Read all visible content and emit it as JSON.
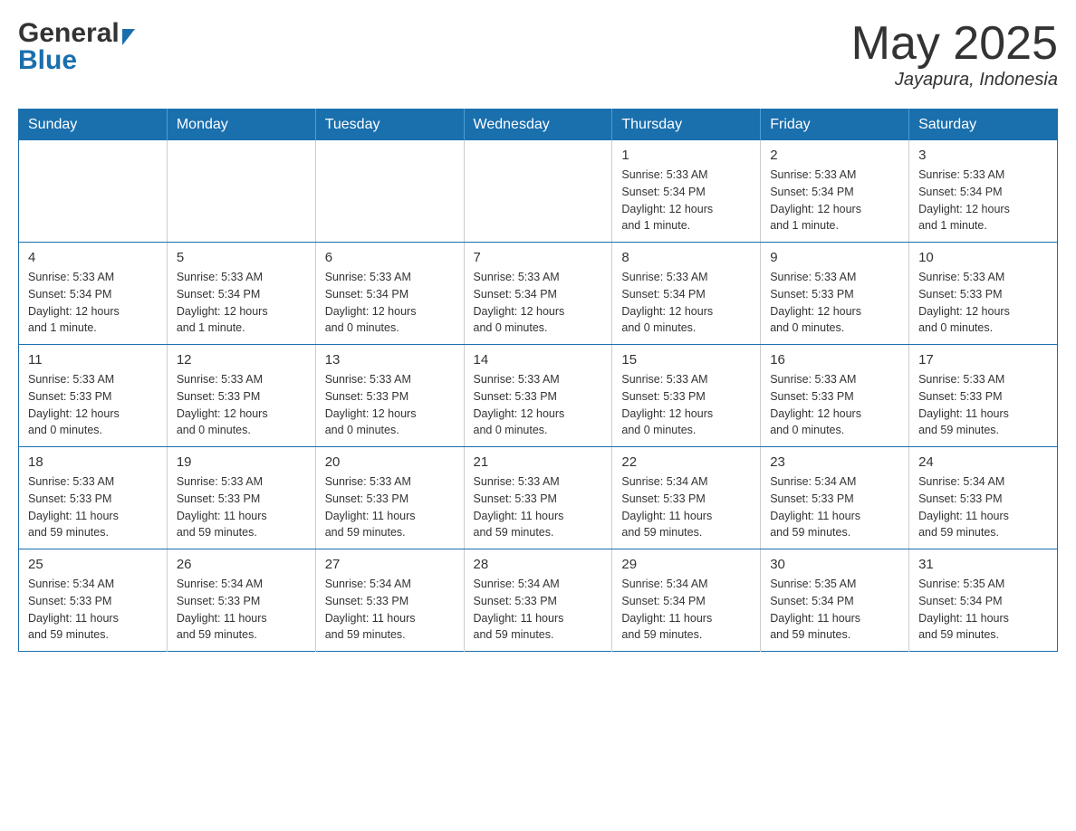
{
  "header": {
    "logo_general": "General",
    "logo_blue": "Blue",
    "title": "May 2025",
    "location": "Jayapura, Indonesia"
  },
  "days_of_week": [
    "Sunday",
    "Monday",
    "Tuesday",
    "Wednesday",
    "Thursday",
    "Friday",
    "Saturday"
  ],
  "weeks": [
    [
      {
        "day": "",
        "info": ""
      },
      {
        "day": "",
        "info": ""
      },
      {
        "day": "",
        "info": ""
      },
      {
        "day": "",
        "info": ""
      },
      {
        "day": "1",
        "info": "Sunrise: 5:33 AM\nSunset: 5:34 PM\nDaylight: 12 hours\nand 1 minute."
      },
      {
        "day": "2",
        "info": "Sunrise: 5:33 AM\nSunset: 5:34 PM\nDaylight: 12 hours\nand 1 minute."
      },
      {
        "day": "3",
        "info": "Sunrise: 5:33 AM\nSunset: 5:34 PM\nDaylight: 12 hours\nand 1 minute."
      }
    ],
    [
      {
        "day": "4",
        "info": "Sunrise: 5:33 AM\nSunset: 5:34 PM\nDaylight: 12 hours\nand 1 minute."
      },
      {
        "day": "5",
        "info": "Sunrise: 5:33 AM\nSunset: 5:34 PM\nDaylight: 12 hours\nand 1 minute."
      },
      {
        "day": "6",
        "info": "Sunrise: 5:33 AM\nSunset: 5:34 PM\nDaylight: 12 hours\nand 0 minutes."
      },
      {
        "day": "7",
        "info": "Sunrise: 5:33 AM\nSunset: 5:34 PM\nDaylight: 12 hours\nand 0 minutes."
      },
      {
        "day": "8",
        "info": "Sunrise: 5:33 AM\nSunset: 5:34 PM\nDaylight: 12 hours\nand 0 minutes."
      },
      {
        "day": "9",
        "info": "Sunrise: 5:33 AM\nSunset: 5:33 PM\nDaylight: 12 hours\nand 0 minutes."
      },
      {
        "day": "10",
        "info": "Sunrise: 5:33 AM\nSunset: 5:33 PM\nDaylight: 12 hours\nand 0 minutes."
      }
    ],
    [
      {
        "day": "11",
        "info": "Sunrise: 5:33 AM\nSunset: 5:33 PM\nDaylight: 12 hours\nand 0 minutes."
      },
      {
        "day": "12",
        "info": "Sunrise: 5:33 AM\nSunset: 5:33 PM\nDaylight: 12 hours\nand 0 minutes."
      },
      {
        "day": "13",
        "info": "Sunrise: 5:33 AM\nSunset: 5:33 PM\nDaylight: 12 hours\nand 0 minutes."
      },
      {
        "day": "14",
        "info": "Sunrise: 5:33 AM\nSunset: 5:33 PM\nDaylight: 12 hours\nand 0 minutes."
      },
      {
        "day": "15",
        "info": "Sunrise: 5:33 AM\nSunset: 5:33 PM\nDaylight: 12 hours\nand 0 minutes."
      },
      {
        "day": "16",
        "info": "Sunrise: 5:33 AM\nSunset: 5:33 PM\nDaylight: 12 hours\nand 0 minutes."
      },
      {
        "day": "17",
        "info": "Sunrise: 5:33 AM\nSunset: 5:33 PM\nDaylight: 11 hours\nand 59 minutes."
      }
    ],
    [
      {
        "day": "18",
        "info": "Sunrise: 5:33 AM\nSunset: 5:33 PM\nDaylight: 11 hours\nand 59 minutes."
      },
      {
        "day": "19",
        "info": "Sunrise: 5:33 AM\nSunset: 5:33 PM\nDaylight: 11 hours\nand 59 minutes."
      },
      {
        "day": "20",
        "info": "Sunrise: 5:33 AM\nSunset: 5:33 PM\nDaylight: 11 hours\nand 59 minutes."
      },
      {
        "day": "21",
        "info": "Sunrise: 5:33 AM\nSunset: 5:33 PM\nDaylight: 11 hours\nand 59 minutes."
      },
      {
        "day": "22",
        "info": "Sunrise: 5:34 AM\nSunset: 5:33 PM\nDaylight: 11 hours\nand 59 minutes."
      },
      {
        "day": "23",
        "info": "Sunrise: 5:34 AM\nSunset: 5:33 PM\nDaylight: 11 hours\nand 59 minutes."
      },
      {
        "day": "24",
        "info": "Sunrise: 5:34 AM\nSunset: 5:33 PM\nDaylight: 11 hours\nand 59 minutes."
      }
    ],
    [
      {
        "day": "25",
        "info": "Sunrise: 5:34 AM\nSunset: 5:33 PM\nDaylight: 11 hours\nand 59 minutes."
      },
      {
        "day": "26",
        "info": "Sunrise: 5:34 AM\nSunset: 5:33 PM\nDaylight: 11 hours\nand 59 minutes."
      },
      {
        "day": "27",
        "info": "Sunrise: 5:34 AM\nSunset: 5:33 PM\nDaylight: 11 hours\nand 59 minutes."
      },
      {
        "day": "28",
        "info": "Sunrise: 5:34 AM\nSunset: 5:33 PM\nDaylight: 11 hours\nand 59 minutes."
      },
      {
        "day": "29",
        "info": "Sunrise: 5:34 AM\nSunset: 5:34 PM\nDaylight: 11 hours\nand 59 minutes."
      },
      {
        "day": "30",
        "info": "Sunrise: 5:35 AM\nSunset: 5:34 PM\nDaylight: 11 hours\nand 59 minutes."
      },
      {
        "day": "31",
        "info": "Sunrise: 5:35 AM\nSunset: 5:34 PM\nDaylight: 11 hours\nand 59 minutes."
      }
    ]
  ]
}
